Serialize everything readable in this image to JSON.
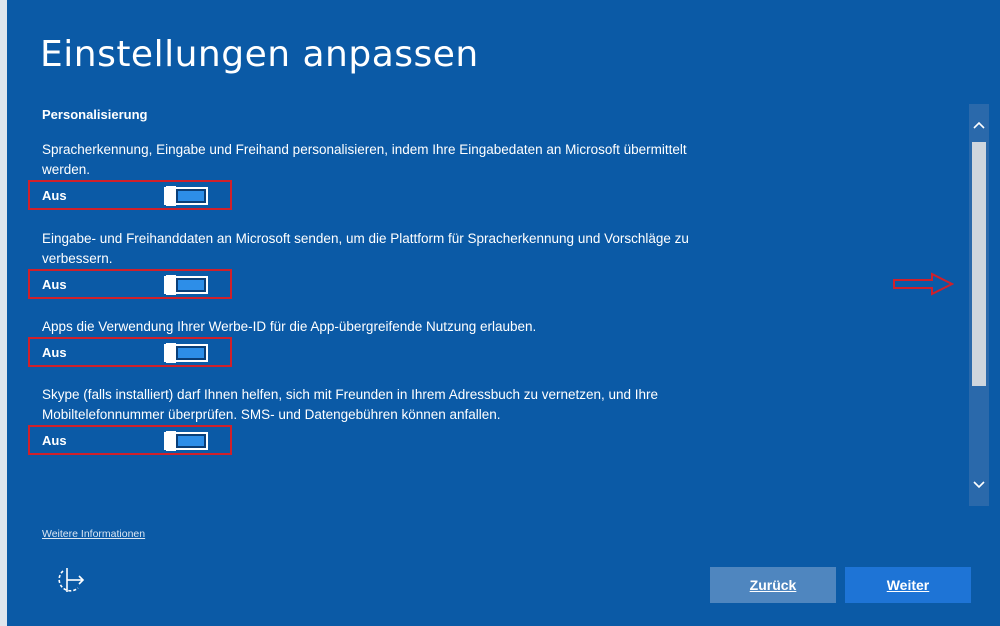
{
  "page": {
    "title": "Einstellungen anpassen"
  },
  "section": {
    "heading": "Personalisierung"
  },
  "settings": [
    {
      "description": "Spracherkennung, Eingabe und Freihand personalisieren, indem Ihre Eingabedaten an Microsoft übermittelt werden.",
      "state_label": "Aus"
    },
    {
      "description": "Eingabe- und Freihanddaten an Microsoft senden, um die Plattform für Spracherkennung und Vorschläge zu verbessern.",
      "state_label": "Aus"
    },
    {
      "description": "Apps die Verwendung Ihrer Werbe-ID für die App-übergreifende Nutzung erlauben.",
      "state_label": "Aus"
    },
    {
      "description": "Skype (falls installiert) darf Ihnen helfen, sich mit Freunden in Ihrem Adressbuch zu vernetzen, und Ihre Mobiltelefonnummer überprüfen. SMS- und Datengebühren können anfallen.",
      "state_label": "Aus"
    }
  ],
  "footer": {
    "more_info": "Weitere Informationen",
    "back_label": "Zurück",
    "next_label": "Weiter"
  },
  "icons": {
    "accessibility": "ease-of-access-icon",
    "scroll_up": "chevron-up-icon",
    "scroll_down": "chevron-down-icon",
    "annotation": "arrow-right-icon"
  },
  "colors": {
    "background": "#0b5aa6",
    "highlight_border": "#d0202a",
    "toggle_fill": "#2d8ee8",
    "next_button": "#1e74d6",
    "back_button": "#4f86bf"
  }
}
